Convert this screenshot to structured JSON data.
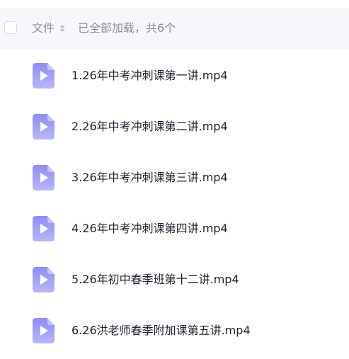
{
  "header": {
    "column_label": "文件",
    "status": "已全部加载，共6个"
  },
  "files": [
    {
      "name": "1.26年中考冲刺课第一讲.mp4",
      "icon": "video-file-icon"
    },
    {
      "name": "2.26年中考冲刺课第二讲.mp4",
      "icon": "video-file-icon"
    },
    {
      "name": "3.26年中考冲刺课第三讲.mp4",
      "icon": "video-file-icon"
    },
    {
      "name": "4.26年中考冲刺课第四讲.mp4",
      "icon": "video-file-icon"
    },
    {
      "name": "5.26年初中春季班第十二讲.mp4",
      "icon": "video-file-icon"
    },
    {
      "name": "6.26洪老师春季附加课第五讲.mp4",
      "icon": "video-file-icon"
    }
  ],
  "colors": {
    "header_bg": "#f6f7fb",
    "icon_gradient_top": "#8f8cf6",
    "icon_gradient_bottom": "#b8b6fb",
    "text": "#1f2330",
    "muted_text": "#8a8f9c"
  }
}
